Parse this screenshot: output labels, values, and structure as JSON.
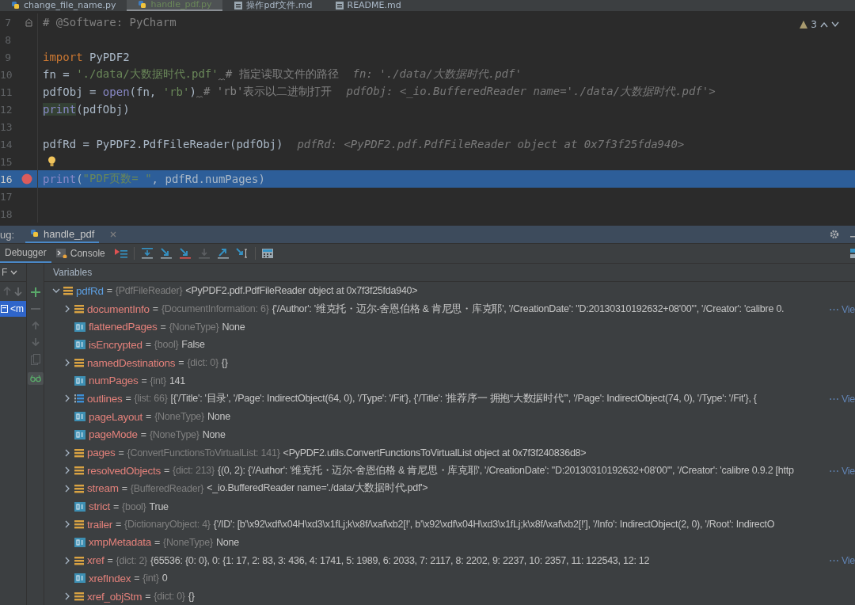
{
  "editor_tabs": [
    {
      "label": "change_file_name.py",
      "kind": "python",
      "selected": false
    },
    {
      "label": "handle_pdf.py",
      "kind": "python",
      "selected": true
    },
    {
      "label": "操作pdf文件.md",
      "kind": "markdown",
      "selected": false
    },
    {
      "label": "README.md",
      "kind": "markdown",
      "selected": false
    }
  ],
  "editor": {
    "warnings": "3",
    "lines": [
      {
        "number": "7",
        "kind": "fold",
        "current": false,
        "tokens": [
          {
            "kind": "comment",
            "text": "# @Software: PyCharm"
          }
        ]
      },
      {
        "number": "8",
        "kind": "code",
        "current": false
      },
      {
        "number": "9",
        "kind": "code",
        "current": false,
        "tokens": [
          {
            "kind": "keyword",
            "text": "import"
          },
          {
            "kind": "plain",
            "text": " PyPDF2"
          }
        ]
      },
      {
        "number": "10",
        "kind": "code",
        "current": false,
        "tokens": [
          {
            "kind": "plain",
            "text": "fn = "
          },
          {
            "kind": "string",
            "text": "'./data/大数据时代.pdf'"
          },
          {
            "kind": "comment",
            "text": "# 指定读取文件的路径",
            "weak_warning": true
          },
          {
            "kind": "hint",
            "text": "fn: './data/大数据时代.pdf'"
          }
        ]
      },
      {
        "number": "11",
        "kind": "code",
        "current": false,
        "tokens": [
          {
            "kind": "plain",
            "text": "pdfObj = "
          },
          {
            "kind": "builtin",
            "text": "open"
          },
          {
            "kind": "plain",
            "text": "(fn, "
          },
          {
            "kind": "string",
            "text": "'rb'"
          },
          {
            "kind": "plain",
            "text": ")"
          },
          {
            "kind": "comment",
            "text": "# 'rb'表示以二进制打开",
            "weak_warning": true
          },
          {
            "kind": "hint",
            "text": "pdfObj: <_io.BufferedReader name='./data/大数据时代.pdf'>"
          }
        ]
      },
      {
        "number": "12",
        "kind": "code",
        "current": false,
        "tokens": [
          {
            "kind": "usage",
            "text": "print"
          },
          {
            "kind": "plain",
            "text": "(pdfObj)"
          }
        ]
      },
      {
        "number": "13",
        "kind": "code",
        "current": false
      },
      {
        "number": "14",
        "kind": "code",
        "current": false,
        "tokens": [
          {
            "kind": "plain",
            "text": "pdfRd = PyPDF2.PdfFileReader(pdfObj)"
          },
          {
            "kind": "hint",
            "text": "pdfRd: <PyPDF2.pdf.PdfFileReader object at 0x7f3f25fda940>"
          }
        ]
      },
      {
        "number": "15",
        "kind": "bulb",
        "current": false
      },
      {
        "number": "16",
        "kind": "breakpoint",
        "current": true,
        "tokens": [
          {
            "kind": "builtin",
            "text": "print"
          },
          {
            "kind": "plain",
            "text": "("
          },
          {
            "kind": "string",
            "text": "\"PDF页数= \""
          },
          {
            "kind": "plain",
            "text": ", pdfRd.numPages)"
          }
        ]
      },
      {
        "number": "17",
        "kind": "code",
        "current": false
      },
      {
        "number": "18",
        "kind": "code",
        "current": false
      }
    ]
  },
  "debug": {
    "label": "ug:",
    "run_tabs": [
      {
        "label": "handle_pdf",
        "selected": true
      }
    ],
    "tool_tabs": [
      {
        "label": "Debugger",
        "kind": "debugger",
        "selected": true
      },
      {
        "label": "Console",
        "kind": "console",
        "selected": false
      }
    ],
    "frames": {
      "filter": "F",
      "items": [
        {
          "label": "<m",
          "selected": true
        }
      ]
    },
    "variables": {
      "header": "Variables",
      "tree": [
        {
          "name": "pdfRd",
          "operator": "=",
          "type": "{PdfFileReader}",
          "value": "<PyPDF2.pdf.PdfFileReader object at 0x7f3f25fda940>",
          "kind": "object",
          "expanded": true,
          "children": [
            {
              "name": "documentInfo",
              "operator": "=",
              "type": "{DocumentInformation: 6}",
              "value": "{'/Author': '维克托・迈尔-舍恩伯格 & 肯尼思・库克耶', '/CreationDate': \"D:20130310192632+08'00'\", '/Creator': 'calibre 0.",
              "kind": "object",
              "expanded": false,
              "link": "⋯ Vie"
            },
            {
              "name": "flattenedPages",
              "operator": "=",
              "type": "{NoneType}",
              "value": "None",
              "kind": "primitive"
            },
            {
              "name": "isEncrypted",
              "operator": "=",
              "type": "{bool}",
              "value": "False",
              "kind": "primitive"
            },
            {
              "name": "namedDestinations",
              "operator": "=",
              "type": "{dict: 0}",
              "value": "{}",
              "kind": "object",
              "expanded": false
            },
            {
              "name": "numPages",
              "operator": "=",
              "type": "{int}",
              "value": "141",
              "kind": "primitive"
            },
            {
              "name": "outlines",
              "operator": "=",
              "type": "{list: 66}",
              "value": "[{'/Title': '目录', '/Page': IndirectObject(64, 0), '/Type': '/Fit'}, {'/Title': '推荐序一 拥抱“大数据时代”', '/Page': IndirectObject(74, 0), '/Type': '/Fit'}, {",
              "kind": "list",
              "expanded": false,
              "link": "⋯ Vie"
            },
            {
              "name": "pageLayout",
              "operator": "=",
              "type": "{NoneType}",
              "value": "None",
              "kind": "primitive"
            },
            {
              "name": "pageMode",
              "operator": "=",
              "type": "{NoneType}",
              "value": "None",
              "kind": "primitive"
            },
            {
              "name": "pages",
              "operator": "=",
              "type": "{ConvertFunctionsToVirtualList: 141}",
              "value": "<PyPDF2.utils.ConvertFunctionsToVirtualList object at 0x7f3f240836d8>",
              "kind": "object",
              "expanded": false
            },
            {
              "name": "resolvedObjects",
              "operator": "=",
              "type": "{dict: 213}",
              "value": "{(0, 2): {'/Author': '维克托・迈尔-舍恩伯格 & 肯尼思・库克耶', '/CreationDate': \"D:20130310192632+08'00'\", '/Creator': 'calibre 0.9.2 [http",
              "kind": "object",
              "expanded": false,
              "link": "⋯ Vie"
            },
            {
              "name": "stream",
              "operator": "=",
              "type": "{BufferedReader}",
              "value": "<_io.BufferedReader name='./data/大数据时代.pdf'>",
              "kind": "object",
              "expanded": false
            },
            {
              "name": "strict",
              "operator": "=",
              "type": "{bool}",
              "value": "True",
              "kind": "primitive"
            },
            {
              "name": "trailer",
              "operator": "=",
              "type": "{DictionaryObject: 4}",
              "value": "{'/ID': [b'\\x92\\xdf\\x04H\\xd3\\x1fLj;k\\x8f/\\xaf\\xb2[!', b'\\x92\\xdf\\x04H\\xd3\\x1fLj;k\\x8f/\\xaf\\xb2[!'], '/Info': IndirectObject(2, 0), '/Root': IndirectO",
              "kind": "object",
              "expanded": false
            },
            {
              "name": "xmpMetadata",
              "operator": "=",
              "type": "{NoneType}",
              "value": "None",
              "kind": "primitive"
            },
            {
              "name": "xref",
              "operator": "=",
              "type": "{dict: 2}",
              "value": "{65536: {0: 0}, 0: {1: 17, 2: 83, 3: 436, 4: 1741, 5: 1989, 6: 2033, 7: 2117, 8: 2202, 9: 2237, 10: 2357, 11: 122543, 12: 12",
              "kind": "object",
              "expanded": false,
              "link": "⋯ Vie"
            },
            {
              "name": "xrefIndex",
              "operator": "=",
              "type": "{int}",
              "value": "0",
              "kind": "primitive"
            },
            {
              "name": "xref_objStm",
              "operator": "=",
              "type": "{dict: 0}",
              "value": "{}",
              "kind": "object",
              "expanded": false
            }
          ]
        }
      ]
    }
  }
}
